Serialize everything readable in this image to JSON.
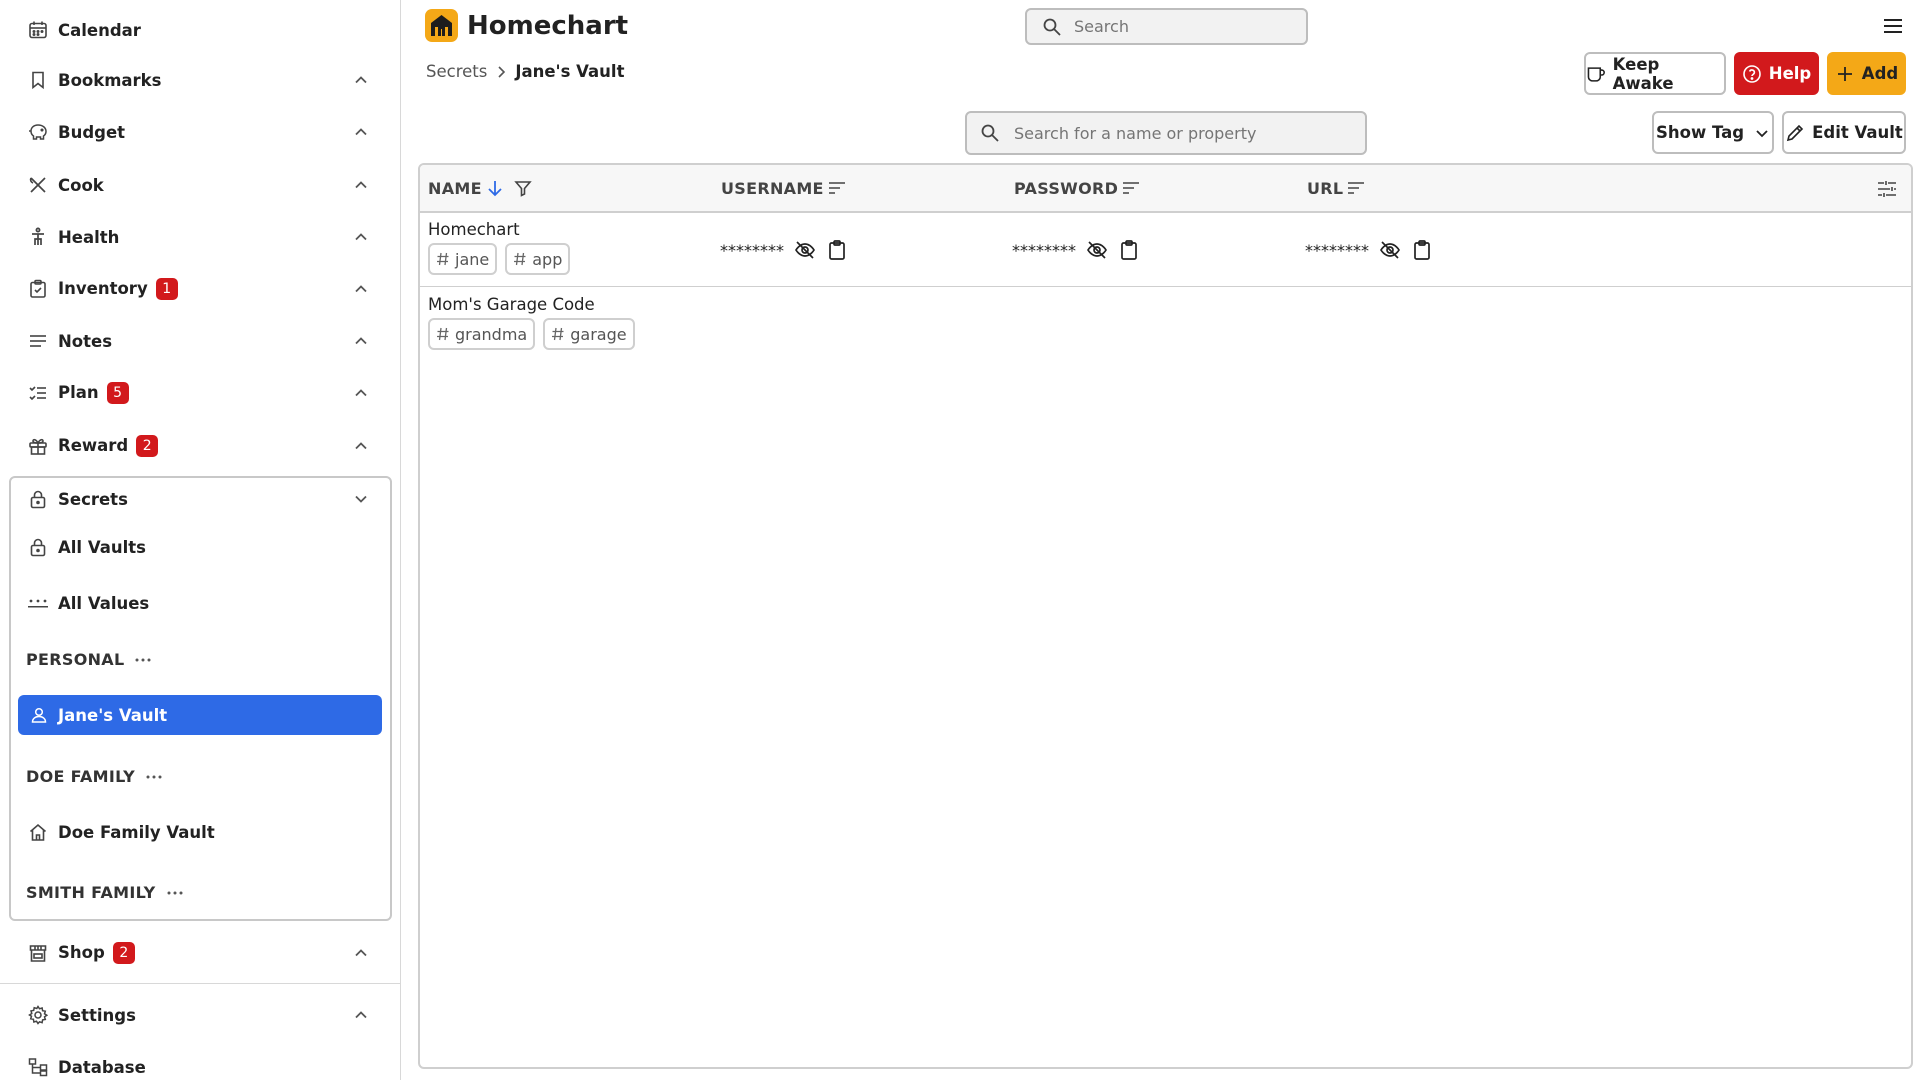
{
  "app": {
    "title": "Homechart"
  },
  "header": {
    "search_placeholder": "Search",
    "buttons": {
      "keep_awake": "Keep Awake",
      "help": "Help",
      "add": "Add"
    }
  },
  "breadcrumb": {
    "parent": "Secrets",
    "current": "Jane's Vault"
  },
  "sidebar": {
    "items": [
      {
        "label": "Calendar",
        "icon": "calendar-icon"
      },
      {
        "label": "Bookmarks",
        "icon": "bookmark-icon"
      },
      {
        "label": "Budget",
        "icon": "piggy-bank-icon"
      },
      {
        "label": "Cook",
        "icon": "utensils-icon"
      },
      {
        "label": "Health",
        "icon": "person-icon"
      },
      {
        "label": "Inventory",
        "icon": "clipboard-icon",
        "badge": "1"
      },
      {
        "label": "Notes",
        "icon": "notes-icon"
      },
      {
        "label": "Plan",
        "icon": "checklist-icon",
        "badge": "5"
      },
      {
        "label": "Reward",
        "icon": "gift-icon",
        "badge": "2"
      }
    ],
    "secrets": {
      "label": "Secrets",
      "all_vaults": "All Vaults",
      "all_values": "All Values",
      "groups": [
        {
          "name": "PERSONAL",
          "vaults": [
            "Jane's Vault"
          ]
        },
        {
          "name": "DOE FAMILY",
          "vaults": [
            "Doe Family Vault"
          ]
        },
        {
          "name": "SMITH FAMILY",
          "vaults": []
        }
      ]
    },
    "shop": {
      "label": "Shop",
      "badge": "2"
    },
    "settings": {
      "label": "Settings"
    },
    "database": {
      "label": "Database"
    }
  },
  "toolbar": {
    "search_placeholder": "Search for a name or property",
    "show_tag": "Show Tag",
    "edit_vault": "Edit Vault"
  },
  "table": {
    "columns": [
      "NAME",
      "USERNAME",
      "PASSWORD",
      "URL"
    ],
    "rows": [
      {
        "name": "Homechart",
        "tags": [
          "jane",
          "app"
        ],
        "username": "********",
        "password": "********",
        "url": "********"
      },
      {
        "name": "Mom's Garage Code",
        "tags": [
          "grandma",
          "garage"
        ]
      }
    ]
  },
  "colors": {
    "accent": "#2e6ae6",
    "brand": "#f4a817",
    "danger": "#d2191c"
  }
}
